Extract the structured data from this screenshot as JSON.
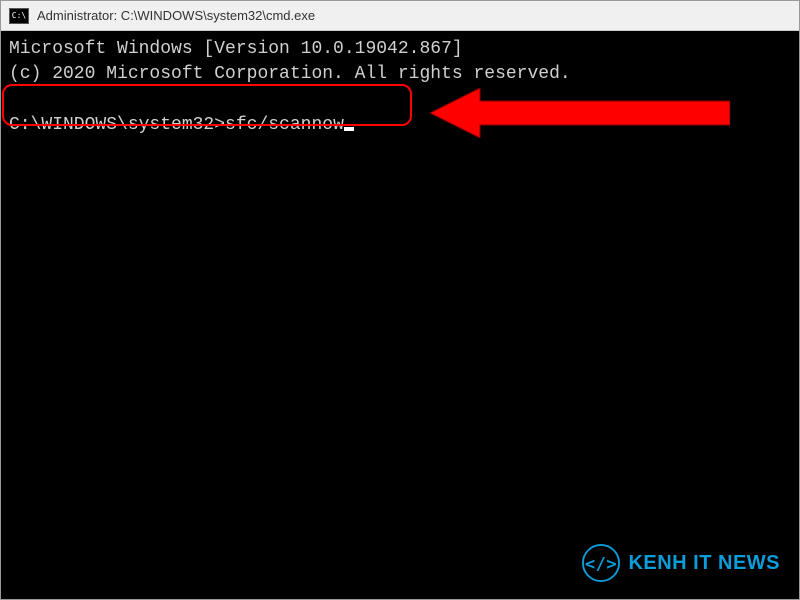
{
  "titlebar": {
    "icon_text": "C:\\",
    "title": "Administrator: C:\\WINDOWS\\system32\\cmd.exe"
  },
  "terminal": {
    "line1": "Microsoft Windows [Version 10.0.19042.867]",
    "line2": "(c) 2020 Microsoft Corporation. All rights reserved.",
    "prompt": "C:\\WINDOWS\\system32>",
    "command": "sfc/scannow"
  },
  "watermark": {
    "text": "KENH IT NEWS"
  },
  "colors": {
    "highlight": "#ff0000",
    "arrow": "#ff0000",
    "watermark": "#0a9dd9"
  }
}
